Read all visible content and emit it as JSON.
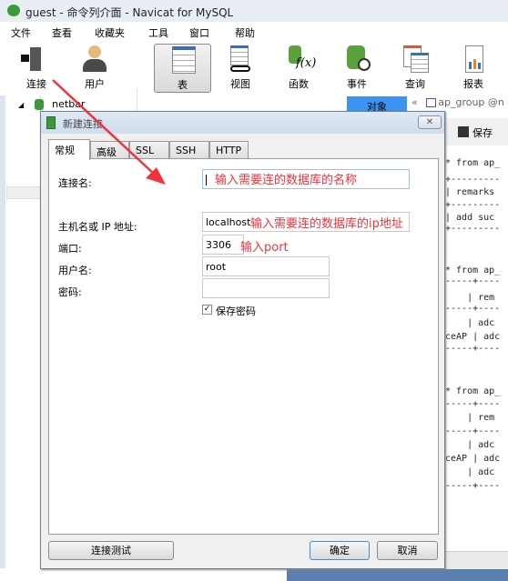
{
  "window": {
    "title": "guest - 命令列介面 - Navicat for MySQL"
  },
  "menu": [
    "文件",
    "查看",
    "收藏夹",
    "工具",
    "窗口",
    "帮助"
  ],
  "toolbar": [
    {
      "label": "连接",
      "icon": "connection-plug-icon"
    },
    {
      "label": "用户",
      "icon": "user-icon"
    },
    {
      "label": "表",
      "icon": "table-icon",
      "active": true
    },
    {
      "label": "视图",
      "icon": "view-icon"
    },
    {
      "label": "函数",
      "icon": "function-icon"
    },
    {
      "label": "事件",
      "icon": "event-icon"
    },
    {
      "label": "查询",
      "icon": "query-icon"
    },
    {
      "label": "报表",
      "icon": "report-icon"
    }
  ],
  "tree": {
    "db": "netbar"
  },
  "object_tab": "对象",
  "editor_tab": "ap_group @n",
  "editor_save": "保存",
  "editor_lines": [
    "* from ap_",
    "+---------",
    "| remarks",
    "+---------",
    "| add suc",
    "+---------",
    "* from ap_",
    "-----+----",
    "    | rem",
    "-----+----",
    "    | adc",
    "ceAP | adc",
    "-----+----",
    "* from ap_",
    "-----+----",
    "    | rem",
    "-----+----",
    "    | adc",
    "ceAP | adc",
    "    | adc",
    "-----+----"
  ],
  "dialog": {
    "title": "新建连接",
    "close": "✕",
    "tabs": [
      "常规",
      "高级",
      "SSL",
      "SSH",
      "HTTP"
    ],
    "fields": {
      "conn_name": {
        "label": "连接名:",
        "value": ""
      },
      "host": {
        "label": "主机名或 IP 地址:",
        "value": "localhost"
      },
      "port": {
        "label": "端口:",
        "value": "3306"
      },
      "user": {
        "label": "用户名:",
        "value": "root"
      },
      "password": {
        "label": "密码:",
        "value": ""
      }
    },
    "save_password": {
      "label": "保存密码",
      "checked": true
    },
    "buttons": {
      "test": "连接测试",
      "ok": "确定",
      "cancel": "取消"
    }
  },
  "annotations": {
    "conn_name": "输入需要连的数据库的名称",
    "host": "输入需要连的数据库的ip地址",
    "port": "输入port"
  },
  "colors": {
    "annotation": "#f0323c",
    "accent": "#3c94f0"
  }
}
